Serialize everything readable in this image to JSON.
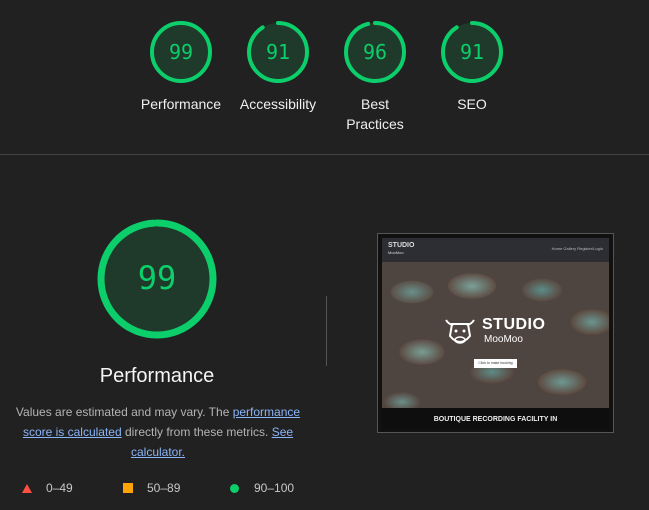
{
  "scores": [
    {
      "value": "99",
      "label_lines": [
        "Performance"
      ]
    },
    {
      "value": "91",
      "label_lines": [
        "Accessibility"
      ]
    },
    {
      "value": "96",
      "label_lines": [
        "Best",
        "Practices"
      ]
    },
    {
      "value": "91",
      "label_lines": [
        "SEO"
      ]
    }
  ],
  "score_fractions": [
    0.99,
    0.91,
    0.96,
    0.91
  ],
  "main": {
    "score": "99",
    "score_fraction": 0.99,
    "title": "Performance",
    "desc_part1": "Values are estimated and may vary. The ",
    "link1": "performance score is calculated",
    "desc_part2": " directly from these metrics. ",
    "link2": "See calculator."
  },
  "legend": [
    {
      "shape": "triangle",
      "range": "0–49"
    },
    {
      "shape": "square",
      "range": "50–89"
    },
    {
      "shape": "circle",
      "range": "90–100"
    }
  ],
  "thumbnail": {
    "logo_line1": "STUDIO",
    "logo_line2": "MooMoo",
    "nav_links": "Home  Gallery  Register/Login",
    "brand_line1": "STUDIO",
    "brand_line2": "MooMoo",
    "cta": "Click to make booking",
    "bottom_text": "BOUTIQUE RECORDING FACILITY IN"
  },
  "colors": {
    "pass": "#0cce6b",
    "average": "#ffa400",
    "fail": "#ff4e42",
    "background": "#212121"
  }
}
